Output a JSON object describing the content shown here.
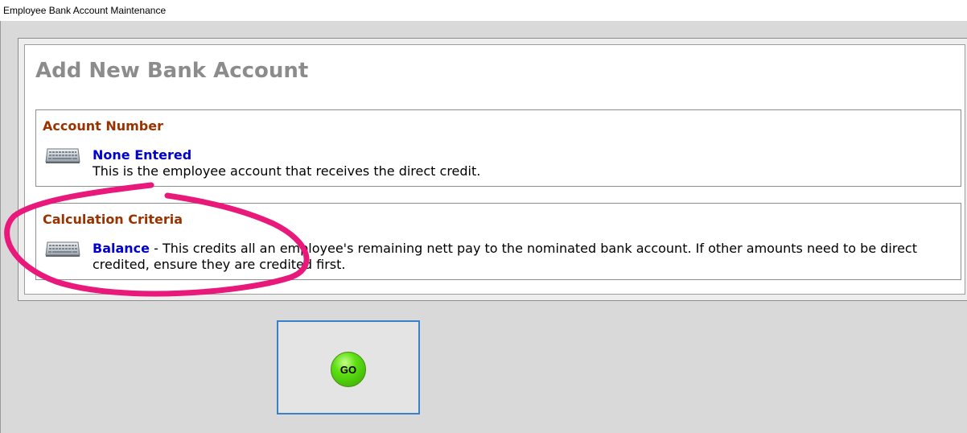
{
  "window": {
    "title": "Employee Bank Account Maintenance"
  },
  "page": {
    "title": "Add New Bank Account"
  },
  "sections": {
    "account_number": {
      "heading": "Account Number",
      "value": "None Entered",
      "description": "This is the employee account that receives the direct credit.",
      "icon": "keyboard-icon"
    },
    "calculation_criteria": {
      "heading": "Calculation Criteria",
      "value": "Balance",
      "description": " - This credits all an employee's remaining nett pay to the nominated bank account. If other amounts need to be direct credited, ensure they are credited first.",
      "icon": "keyboard-icon"
    }
  },
  "actions": {
    "go_label": "GO"
  },
  "colors": {
    "heading": "#993300",
    "link": "#0000cc",
    "title_gray": "#8c8c8c",
    "go_green": "#5ee014",
    "focus_border": "#3a7fc8",
    "annotation_pink": "#e8197a"
  }
}
